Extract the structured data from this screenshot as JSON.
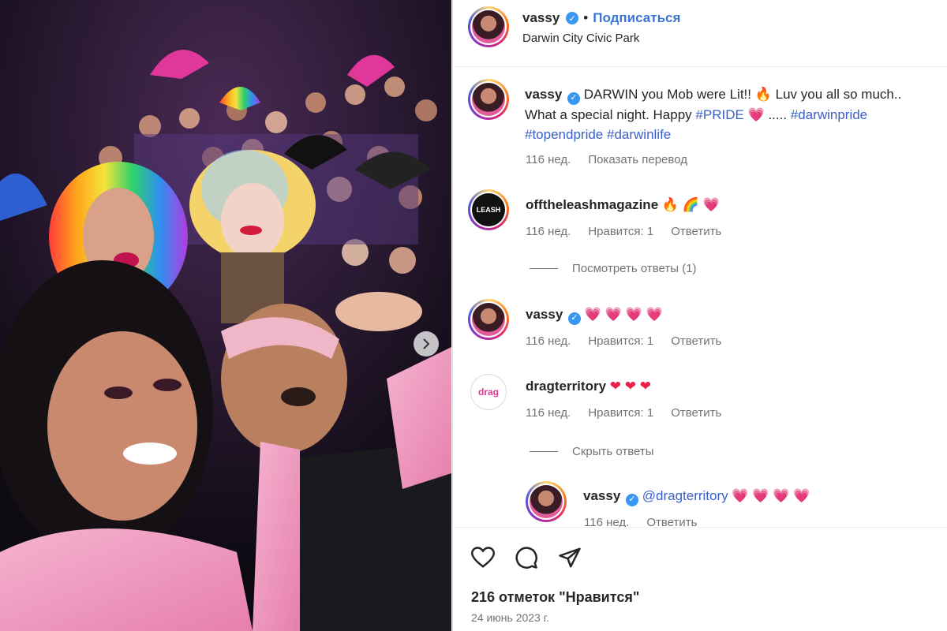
{
  "post": {
    "photo_alt": "Group selfie at Darwin Pride event",
    "author": "vassy",
    "follow_label": "Подписаться",
    "location": "Darwin City Civic Park"
  },
  "caption": {
    "author": "vassy",
    "text_a": "DARWIN you Mob were Lit!! ",
    "text_b": " Luv you all so much.. What a special night. Happy ",
    "tag_pride": "#PRIDE",
    "text_c": " ..... ",
    "tag_darwinpride": "#darwinpride",
    "tag_topendpride": "#topendpride",
    "tag_darwinlife": "#darwinlife",
    "age": "116 нед.",
    "translate": "Показать перевод"
  },
  "comments": [
    {
      "author": "offtheleashmagazine",
      "age": "116 нед.",
      "likes": "Нравится: 1",
      "reply": "Ответить",
      "view_replies": "Посмотреть ответы (1)"
    },
    {
      "author": "vassy",
      "age": "116 нед.",
      "likes": "Нравится: 1",
      "reply": "Ответить"
    },
    {
      "author": "dragterritory",
      "age": "116 нед.",
      "likes": "Нравится: 1",
      "reply": "Ответить",
      "hide_replies": "Скрыть ответы"
    }
  ],
  "reply": {
    "author": "vassy",
    "mention": "@dragterritory",
    "age": "116 нед.",
    "reply": "Ответить"
  },
  "footer": {
    "likes": "216 отметок \"Нравится\"",
    "date": "24 июнь 2023 г."
  },
  "emoji": {
    "fire": "🔥",
    "rainbow": "🌈",
    "pink_heart": "💗",
    "red_heart": "❤"
  },
  "icons": [
    "heart-icon",
    "comment-icon",
    "share-icon",
    "verified-icon",
    "chevron-right-icon"
  ],
  "colors": {
    "accent": "#3b73d6",
    "hashtag": "#3b5fc9",
    "verified": "#3897f0",
    "muted": "#737373"
  }
}
